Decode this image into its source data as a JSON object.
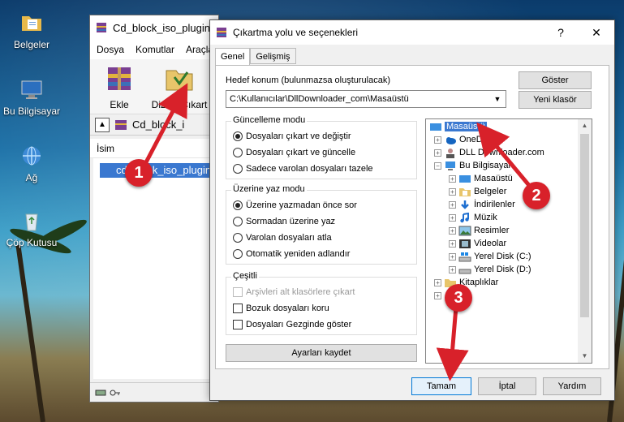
{
  "desktop": {
    "icons": [
      {
        "label": "Belgeler",
        "icon": "folder-documents-icon"
      },
      {
        "label": "Bu Bilgisayar",
        "icon": "computer-icon"
      },
      {
        "label": "Ağ",
        "icon": "network-icon"
      },
      {
        "label": "Çöp Kutusu",
        "icon": "recycle-bin-icon"
      }
    ]
  },
  "winrar": {
    "title": "Cd_block_iso_plugin",
    "menu": [
      "Dosya",
      "Komutlar",
      "Araçla"
    ],
    "toolbar": {
      "add_label": "Ekle",
      "extract_label": "Dizine Çıkart"
    },
    "path": "Cd_block_i",
    "column_name": "İsim",
    "file_name": "cd_block_iso_plugin"
  },
  "dialog": {
    "title": "Çıkartma yolu ve seçenekleri",
    "help_glyph": "?",
    "close_glyph": "✕",
    "tabs": [
      "Genel",
      "Gelişmiş"
    ],
    "destination_label": "Hedef konum (bulunmazsa oluşturulacak)",
    "destination_value": "C:\\Kullanıcılar\\DllDownloader_com\\Masaüstü",
    "show_button": "Göster",
    "new_folder_button": "Yeni klasör",
    "update_mode": {
      "title": "Güncelleme modu",
      "options": [
        "Dosyaları çıkart ve değiştir",
        "Dosyaları çıkart ve güncelle",
        "Sadece varolan dosyaları tazele"
      ],
      "selected_index": 0
    },
    "overwrite_mode": {
      "title": "Üzerine yaz modu",
      "options": [
        "Üzerine yazmadan önce sor",
        "Sormadan üzerine yaz",
        "Varolan dosyaları atla",
        "Otomatik yeniden adlandır"
      ],
      "selected_index": 0
    },
    "misc": {
      "title": "Çeşitli",
      "options": [
        {
          "label": "Arşivleri alt klasörlere çıkart",
          "checked": false,
          "disabled": true
        },
        {
          "label": "Bozuk dosyaları koru",
          "checked": false,
          "disabled": false
        },
        {
          "label": "Dosyaları Gezginde göster",
          "checked": false,
          "disabled": false
        }
      ]
    },
    "save_settings_button": "Ayarları kaydet",
    "tree": [
      {
        "label": "Masaüstü",
        "selected": true
      },
      {
        "label": "OneDrive"
      },
      {
        "label": "DLL Downloader.com"
      },
      {
        "label": "Bu Bilgisayar"
      },
      {
        "label": "Masaüstü"
      },
      {
        "label": "Belgeler"
      },
      {
        "label": "İndirilenler"
      },
      {
        "label": "Müzik"
      },
      {
        "label": "Resimler"
      },
      {
        "label": "Videolar"
      },
      {
        "label": "Yerel Disk (C:)"
      },
      {
        "label": "Yerel Disk (D:)"
      },
      {
        "label": "Kitaplıklar"
      },
      {
        "label": ""
      }
    ],
    "ok_button": "Tamam",
    "cancel_button": "İptal",
    "help_button": "Yardım"
  },
  "annotations": {
    "markers": [
      "1",
      "2",
      "3"
    ],
    "color": "#d8212a"
  },
  "colors": {
    "selection": "#3a78d0",
    "marker": "#d8212a",
    "default_button_border": "#0078d7"
  }
}
